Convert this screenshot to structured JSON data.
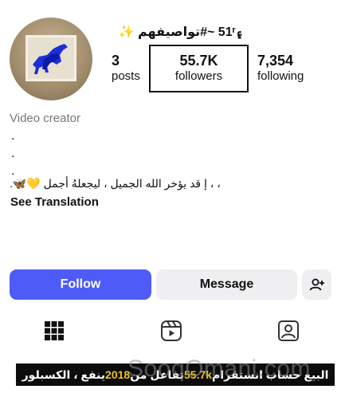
{
  "profile": {
    "username": "۽51ʳ ~#تواصيفهم ✨",
    "category": "Video creator",
    "bio_dots": [
      ".",
      ".",
      "."
    ],
    "bio_text": "، ، ‌إ قد يؤخر الله الجميل ، ليجعلهُ أجمل 💛🦋.",
    "see_translation": "See Translation"
  },
  "stats": {
    "posts": {
      "value": "3",
      "label": "posts"
    },
    "followers": {
      "value": "55.7K",
      "label": "followers"
    },
    "following": {
      "value": "7,354",
      "label": "following"
    }
  },
  "actions": {
    "follow_label": "Follow",
    "message_label": "Message"
  },
  "tabs": [
    "grid-icon",
    "reels-icon",
    "tagged-icon"
  ],
  "banner": {
    "part1": "البيع حساب انستقرام ",
    "highlight1": "55.7k",
    "part2": " تفاعل من ",
    "highlight2": "2018",
    "part3": " ينفع ، الكسبلور"
  },
  "watermark": "SooqOmani.com",
  "colors": {
    "follow_button": "#4f5bf7",
    "banner_bg": "#0c0c0c",
    "banner_highlight": "#f0c419"
  }
}
